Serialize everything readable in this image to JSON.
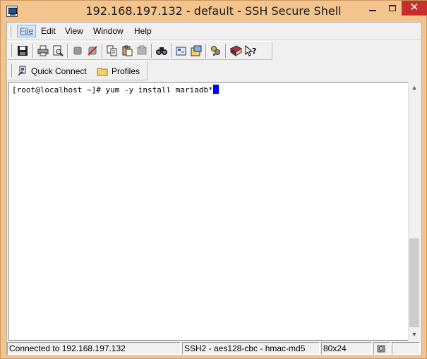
{
  "window": {
    "title": "192.168.197.132 - default - SSH Secure Shell"
  },
  "controls": {
    "minimize_icon": "minimize-icon",
    "maximize_icon": "maximize-icon",
    "close_glyph": "✕"
  },
  "menu": {
    "items": [
      "File",
      "Edit",
      "View",
      "Window",
      "Help"
    ],
    "active": "File"
  },
  "toolbar": {
    "icons": [
      "save-icon",
      "print-icon",
      "print-preview-icon",
      "connect-icon",
      "disconnect-icon",
      "copy-icon",
      "paste-icon",
      "paste-disabled-icon",
      "find-icon",
      "settings-icon",
      "new-window-icon",
      "key-icon",
      "book-help-icon",
      "context-help-icon"
    ]
  },
  "quickbar": {
    "quick_connect": "Quick Connect",
    "profiles": "Profiles"
  },
  "terminal": {
    "prompt": "[root@localhost ~]# ",
    "command": "yum -y install mariadb*"
  },
  "statusbar": {
    "connection": "Connected to 192.168.197.132",
    "cipher": "SSH2 - aes128-cbc - hmac-md5",
    "size": "80x24"
  },
  "colors": {
    "titlebar": "#f4c48e",
    "close_button": "#c7302a",
    "cursor": "#0000ff"
  }
}
